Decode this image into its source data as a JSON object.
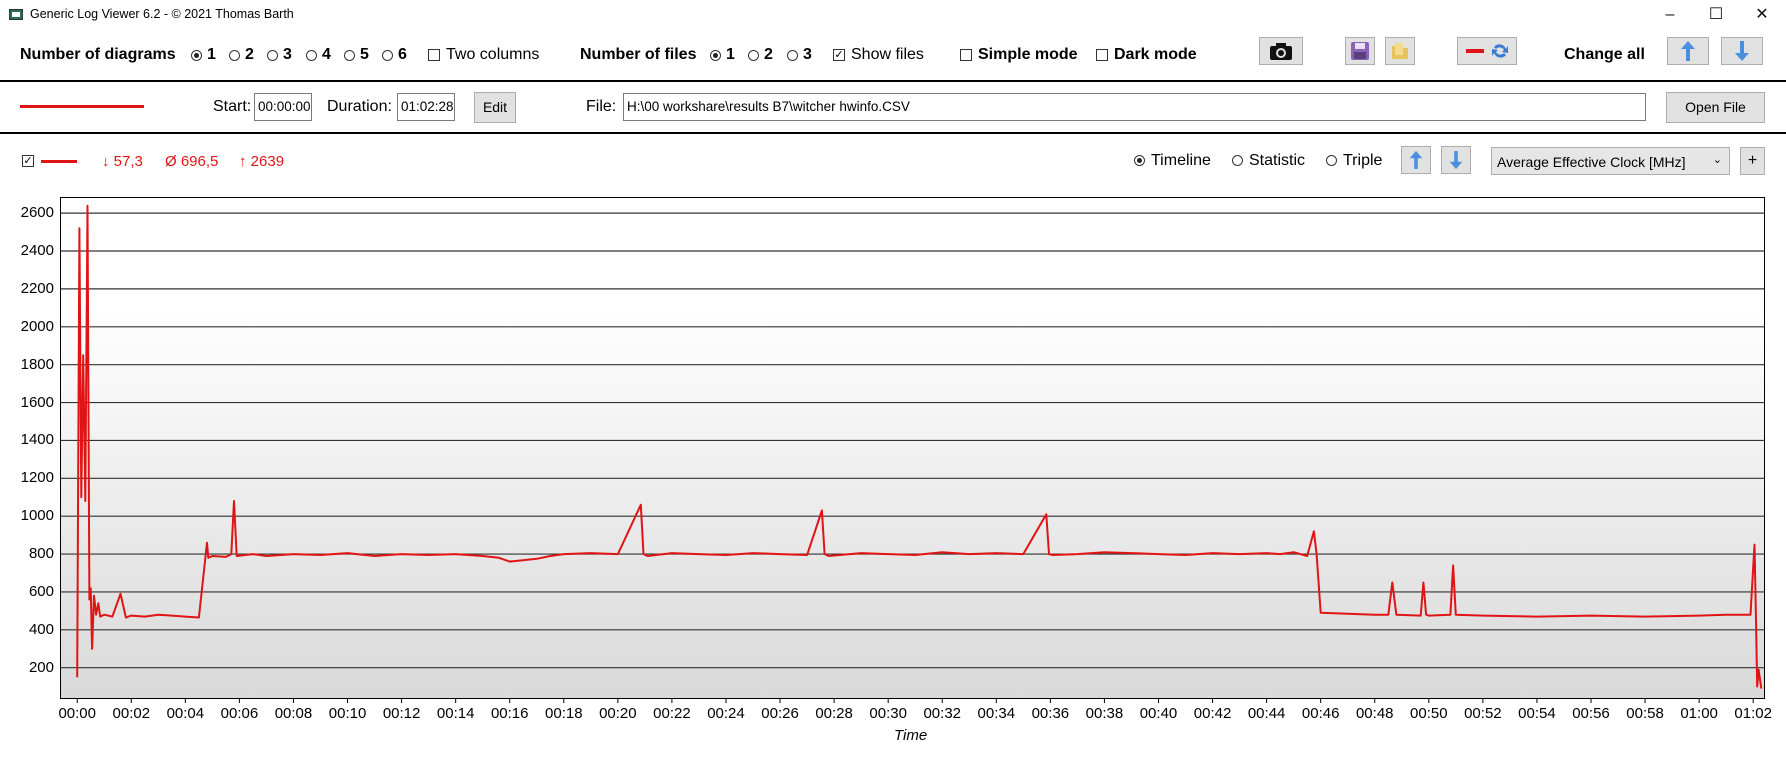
{
  "window": {
    "title": "Generic Log Viewer 6.2 - © 2021 Thomas Barth",
    "minimize": "–",
    "maximize": "☐",
    "close": "✕"
  },
  "toolbar": {
    "diagrams_label": "Number of diagrams",
    "diagram_options": [
      "1",
      "2",
      "3",
      "4",
      "5",
      "6"
    ],
    "diagram_selected": "1",
    "two_columns": "Two columns",
    "files_label": "Number of files",
    "file_options": [
      "1",
      "2",
      "3"
    ],
    "file_selected": "1",
    "show_files": "Show files",
    "show_files_checked": true,
    "simple_mode": "Simple mode",
    "dark_mode": "Dark mode",
    "change_all": "Change all"
  },
  "file_row": {
    "start_label": "Start:",
    "start_value": "00:00:00",
    "duration_label": "Duration:",
    "duration_value": "01:02:28",
    "edit": "Edit",
    "file_label": "File:",
    "file_path": "H:\\00 workshare\\results B7\\witcher hwinfo.CSV",
    "open_file": "Open File",
    "line_color": "#e01414"
  },
  "diagram": {
    "min": "↓ 57,3",
    "avg": "Ø 696,5",
    "max": "↑ 2639",
    "mode_options": [
      "Timeline",
      "Statistic",
      "Triple"
    ],
    "mode_selected": "Timeline",
    "metric": "Average Effective Clock [MHz]",
    "add": "+"
  },
  "chart_data": {
    "type": "line",
    "xlabel": "Time",
    "ylabel": "",
    "ylim": [
      40,
      2680
    ],
    "xlim_minutes": [
      -0.6,
      62.4
    ],
    "yticks": [
      200,
      400,
      600,
      800,
      1000,
      1200,
      1400,
      1600,
      1800,
      2000,
      2200,
      2400,
      2600
    ],
    "xticks": [
      "00:00",
      "00:02",
      "00:04",
      "00:06",
      "00:08",
      "00:10",
      "00:12",
      "00:14",
      "00:16",
      "00:18",
      "00:20",
      "00:22",
      "00:24",
      "00:26",
      "00:28",
      "00:30",
      "00:32",
      "00:34",
      "00:36",
      "00:38",
      "00:40",
      "00:42",
      "00:44",
      "00:46",
      "00:48",
      "00:50",
      "00:52",
      "00:54",
      "00:56",
      "00:58",
      "01:00",
      "01:02"
    ],
    "grid": true,
    "series": [
      {
        "color": "#e01414",
        "x_minutes": [
          0.0,
          0.08,
          0.15,
          0.22,
          0.3,
          0.38,
          0.45,
          0.5,
          0.55,
          0.62,
          0.7,
          0.78,
          0.85,
          1.0,
          1.3,
          1.6,
          1.8,
          2.0,
          2.5,
          3.0,
          3.5,
          4.0,
          4.5,
          4.8,
          4.85,
          5.0,
          5.5,
          5.7,
          5.8,
          5.9,
          6.5,
          7.0,
          8.0,
          9.0,
          10.0,
          11.0,
          12.0,
          13.0,
          14.0,
          15.0,
          15.6,
          16.0,
          17.0,
          17.5,
          18.0,
          19.0,
          20.0,
          20.85,
          20.95,
          21.1,
          22.0,
          23.0,
          24.0,
          25.0,
          26.0,
          27.0,
          27.55,
          27.65,
          27.8,
          29.0,
          30.0,
          31.0,
          32.0,
          33.0,
          34.0,
          35.0,
          35.85,
          35.95,
          36.1,
          37.0,
          38.0,
          39.0,
          40.0,
          41.0,
          42.0,
          43.0,
          44.0,
          44.5,
          45.0,
          45.5,
          45.75,
          45.85,
          46.0,
          47.0,
          48.0,
          48.5,
          48.65,
          48.8,
          49.7,
          49.8,
          49.9,
          50.0,
          50.8,
          50.9,
          51.0,
          52.0,
          54.0,
          56.0,
          58.0,
          60.0,
          61.0,
          61.9,
          62.05,
          62.1,
          62.15,
          62.2,
          62.3
        ],
        "values": [
          150,
          2520,
          1100,
          1850,
          1080,
          2639,
          560,
          620,
          300,
          580,
          480,
          540,
          470,
          480,
          470,
          590,
          465,
          475,
          470,
          480,
          475,
          470,
          465,
          860,
          780,
          790,
          785,
          800,
          1080,
          790,
          800,
          790,
          800,
          795,
          805,
          790,
          800,
          795,
          800,
          790,
          780,
          760,
          775,
          790,
          800,
          805,
          800,
          1060,
          800,
          790,
          805,
          800,
          795,
          805,
          800,
          795,
          1030,
          800,
          790,
          805,
          800,
          795,
          810,
          800,
          805,
          800,
          1010,
          800,
          795,
          800,
          810,
          805,
          800,
          795,
          805,
          800,
          805,
          800,
          810,
          790,
          920,
          800,
          490,
          485,
          480,
          480,
          650,
          480,
          475,
          650,
          480,
          475,
          480,
          740,
          480,
          475,
          470,
          475,
          470,
          475,
          480,
          480,
          850,
          480,
          100,
          190,
          90
        ]
      }
    ]
  }
}
